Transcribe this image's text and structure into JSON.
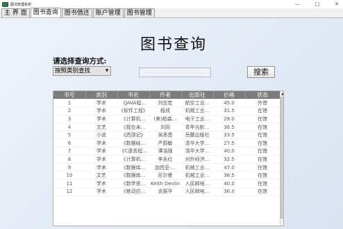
{
  "window": {
    "title": "图书管理系统",
    "controls": [
      "—",
      "□",
      "✕"
    ]
  },
  "tabs": [
    {
      "label": "主 界 面",
      "active": false
    },
    {
      "label": "图书查询",
      "active": true
    },
    {
      "label": "图书借还",
      "active": false
    },
    {
      "label": "账户管理",
      "active": false
    },
    {
      "label": "图书管理",
      "active": false
    }
  ],
  "main": {
    "heading": "图书查询",
    "prompt_label": "请选择查询方式:",
    "search_mode": {
      "selected": "按照类别查找"
    },
    "search_input": {
      "value": "",
      "placeholder": ""
    },
    "search_button": "搜索"
  },
  "table": {
    "columns": [
      "书号",
      "类别",
      "书名",
      "作者",
      "出版社",
      "价格",
      "状态"
    ],
    "rows": [
      [
        "1",
        "学术",
        "《JAVA程...",
        "刘志宏",
        "航空工业...",
        "45.0",
        "外借"
      ],
      [
        "2",
        "学术",
        "《软件工程》",
        "程成",
        "机械工业...",
        "31.5",
        "在馆"
      ],
      [
        "3",
        "学术",
        "《计算机...",
        "(美)帕森...",
        "电子工业...",
        "28.0",
        "在馆"
      ],
      [
        "4",
        "文艺",
        "《我在未...",
        "刘同",
        "青年光影...",
        "36.5",
        "在馆"
      ],
      [
        "5",
        "小说",
        "《西游记》",
        "吴承恩",
        "岳麓出版社",
        "33.5",
        "在馆"
      ],
      [
        "6",
        "学术",
        "《数据结...",
        "严蔚敏",
        "清华大学...",
        "27.5",
        "在馆"
      ],
      [
        "7",
        "学术",
        "《C语言程...",
        "谭浩强",
        "清华大学...",
        "40.0",
        "在馆"
      ],
      [
        "8",
        "学术",
        "《计算机...",
        "李永红",
        "对外经济...",
        "32.5",
        "在馆"
      ],
      [
        "9",
        "学术",
        "《数据库...",
        "加西亚-...",
        "机械工业...",
        "47.0",
        "在馆"
      ],
      [
        "10",
        "文艺",
        "《数据库...",
        "尼尔曼",
        "机械工业...",
        "38.5",
        "在馆"
      ],
      [
        "11",
        "学术",
        "《数学思...",
        "Keith Devlin",
        "人民邮电...",
        "40.0",
        "在馆"
      ],
      [
        "12",
        "学术",
        "《移动应...",
        "余振华",
        "人民邮电...",
        "36.0",
        "在馆"
      ]
    ]
  },
  "colors": {
    "header_bg": "#7b7b7b",
    "panel_bg": "#e6edf7",
    "app_icon": "#2f7d4a"
  }
}
